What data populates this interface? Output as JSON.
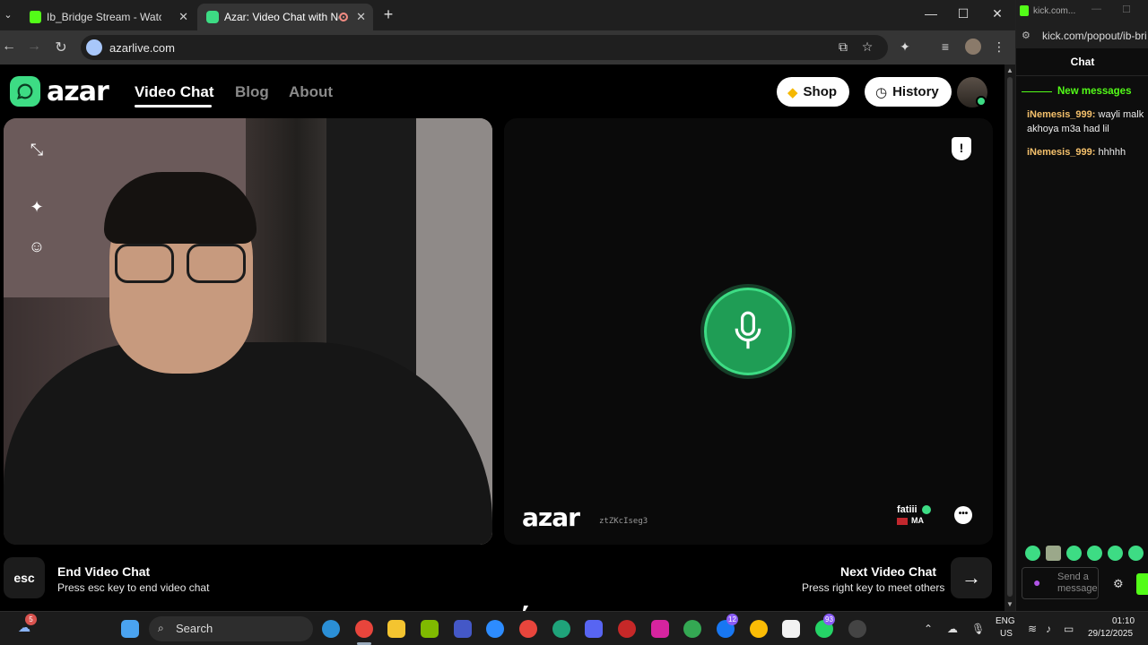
{
  "browser": {
    "tabs": [
      {
        "title": "Ib_Bridge Stream - Watch Live",
        "close": "✕"
      },
      {
        "title": "Azar: Video Chat with New",
        "close": "✕"
      }
    ],
    "new_tab": "+",
    "window_controls": {
      "minimize": "—",
      "maximize": "☐",
      "close": "✕"
    },
    "nav": {
      "back": "←",
      "forward": "→",
      "reload": "↻"
    },
    "url": "azarlive.com",
    "toolbar_icons": [
      "install-icon",
      "star-icon",
      "extensions-icon",
      "media-icon",
      "profile-icon",
      "menu-icon"
    ]
  },
  "azar": {
    "logo_text": "azar",
    "nav": {
      "video_chat": "Video Chat",
      "blog": "Blog",
      "about": "About"
    },
    "shop_label": "Shop",
    "history_label": "History",
    "peer": {
      "watermark_logo": "azar",
      "watermark_code": "ztZKcIseg3",
      "name": "fatiii",
      "country": "MA"
    },
    "footer": {
      "esc_key": "esc",
      "end_title": "End Video Chat",
      "end_sub": "Press esc key to end video chat",
      "next_title": "Next Video Chat",
      "next_sub": "Press right key to meet others",
      "next_arrow": "→"
    },
    "colors": {
      "accent": "#3ddc84",
      "mic_bg": "#1f9d55"
    }
  },
  "kick": {
    "window_title": "kick.com...",
    "url": "kick.com/popout/ib-bri",
    "chat_title": "Chat",
    "new_messages": "New messages",
    "messages": [
      {
        "user": "iNemesis_999:",
        "text": " wayli malk akhoya m3a had lil"
      },
      {
        "user": "iNemesis_999:",
        "text": " hhhhh"
      }
    ],
    "input_placeholder": "Send a message",
    "colors": {
      "brand": "#53fc18"
    }
  },
  "taskbar": {
    "search_label": "Search",
    "weather_badge": "5",
    "facebook_badge": "12",
    "whatsapp_badge": "93",
    "language_top": "ENG",
    "language_bottom": "US",
    "time": "01:10",
    "date": "29/12/2025"
  }
}
